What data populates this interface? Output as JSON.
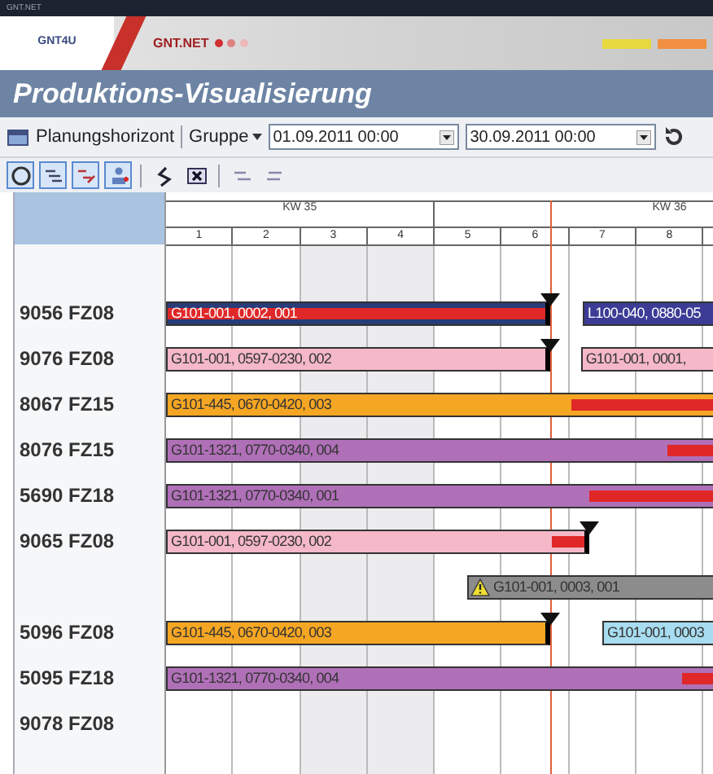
{
  "window": {
    "title": "GNT.NET"
  },
  "banner": {
    "logo": "GNT4U",
    "brand": "GNT.NET"
  },
  "page_title": "Produktions-Visualisierung",
  "toolbar": {
    "horizon_label": "Planungshorizont",
    "group_label": "Gruppe",
    "from": "01.09.2011 00:00",
    "to": "30.09.2011 00:00"
  },
  "tools": [
    {
      "selected": true
    },
    {
      "selected": true
    },
    {
      "selected": true
    },
    {
      "selected": true
    },
    {
      "selected": false
    },
    {
      "selected": false
    },
    {
      "selected": false
    },
    {
      "selected": false
    }
  ],
  "gantt": {
    "weeks": [
      {
        "label": "KW 35"
      },
      {
        "label": "KW 36"
      }
    ],
    "days": [
      {
        "label": "1",
        "weekend": false
      },
      {
        "label": "2",
        "weekend": false
      },
      {
        "label": "3",
        "weekend": true
      },
      {
        "label": "4",
        "weekend": true
      },
      {
        "label": "5",
        "weekend": false
      },
      {
        "label": "6",
        "weekend": false
      },
      {
        "label": "7",
        "weekend": false
      },
      {
        "label": "8",
        "weekend": false
      }
    ],
    "rows": [
      {
        "label": "",
        "bars": []
      },
      {
        "label": "9056 FZ08",
        "bars": [
          {
            "text": "G101-001, 0002, 001",
            "color": "#283c78",
            "overdue": true,
            "end_marker": true
          },
          {
            "text": "L100-040, 0880-05",
            "color": "#3c3c96",
            "overdue": false
          }
        ]
      },
      {
        "label": "9076 FZ08",
        "bars": [
          {
            "text": "G101-001, 0597-0230, 002",
            "color": "#f4b8c8",
            "overdue": false,
            "end_marker": true
          },
          {
            "text": "G101-001, 0001,",
            "color": "#f4b8c8",
            "overdue": false
          }
        ]
      },
      {
        "label": "8067 FZ15",
        "bars": [
          {
            "text": "G101-445, 0670-0420, 003",
            "color": "#f5a623",
            "overdue": true
          }
        ]
      },
      {
        "label": "8076 FZ15",
        "bars": [
          {
            "text": "G101-1321, 0770-0340, 004",
            "color": "#b070b8",
            "overdue": true
          }
        ]
      },
      {
        "label": "5690 FZ18",
        "bars": [
          {
            "text": "G101-1321, 0770-0340, 001",
            "color": "#b070b8",
            "overdue": true
          }
        ]
      },
      {
        "label": "9065 FZ08",
        "bars": [
          {
            "text": "G101-001, 0597-0230, 002",
            "color": "#f4b8c8",
            "overdue": true,
            "end_marker": true
          }
        ]
      },
      {
        "label": "",
        "bars": [
          {
            "text": "G101-001, 0003, 001",
            "color": "#8c8c8c",
            "overdue": false,
            "warning": true
          }
        ]
      },
      {
        "label": "5096 FZ08",
        "bars": [
          {
            "text": "G101-445, 0670-0420, 003",
            "color": "#f5a623",
            "overdue": false,
            "end_marker": true
          },
          {
            "text": "G101-001, 0003",
            "color": "#a8dcf0",
            "overdue": false
          }
        ]
      },
      {
        "label": "5095 FZ18",
        "bars": [
          {
            "text": "G101-1321, 0770-0340, 004",
            "color": "#b070b8",
            "overdue": true
          }
        ]
      },
      {
        "label": "9078 FZ08",
        "bars": []
      }
    ]
  }
}
